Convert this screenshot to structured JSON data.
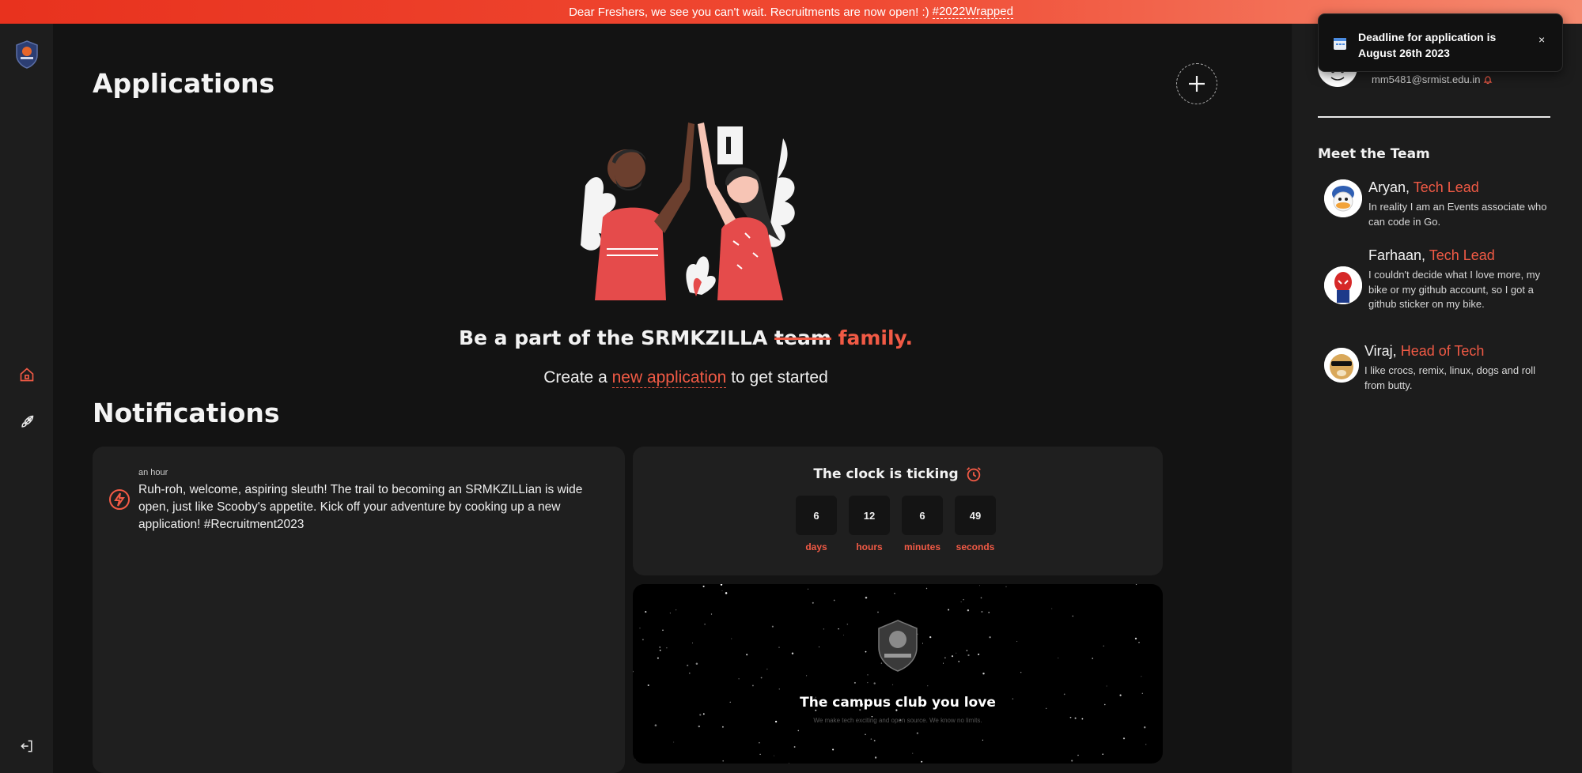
{
  "banner": {
    "text": "Dear Freshers, we see you can't wait. Recruitments are now open! :)",
    "tag": "#2022Wrapped"
  },
  "sidebar": {
    "logo_icon": "srmkzilla-shield-logo",
    "items": [
      {
        "icon": "home-icon",
        "active": true
      },
      {
        "icon": "rocket-icon",
        "active": false
      }
    ],
    "logout_icon": "logout-icon"
  },
  "applications": {
    "heading": "Applications",
    "add_icon": "plus-icon",
    "tagline_prefix": "Be a part of the SRMKZILLA",
    "tagline_struck": "team",
    "tagline_accent": "family.",
    "sub_prefix": "Create a",
    "sub_link": "new application",
    "sub_suffix": "to get started"
  },
  "notifications": {
    "heading": "Notifications",
    "items": [
      {
        "icon": "lightning-icon",
        "time": "an hour",
        "message": "Ruh-roh, welcome, aspiring sleuth! The trail to becoming an SRMKZILLian is wide open, just like Scooby's appetite. Kick off your adventure by cooking up a new application! #Recruitment2023"
      }
    ]
  },
  "countdown": {
    "title": "The clock is ticking",
    "icon": "alarm-clock-icon",
    "units": [
      {
        "value": "6",
        "label": "days"
      },
      {
        "value": "12",
        "label": "hours"
      },
      {
        "value": "6",
        "label": "minutes"
      },
      {
        "value": "49",
        "label": "seconds"
      }
    ]
  },
  "promo": {
    "title": "The campus club you love",
    "subtitle": "We make tech exciting and open source. We know no limits."
  },
  "profile": {
    "email": "mm5481@srmist.edu.in",
    "bell_icon": "bell-icon"
  },
  "team": {
    "heading": "Meet the Team",
    "members": [
      {
        "name": "Aryan,",
        "role": "Tech Lead",
        "bio": "In reality I am an Events associate who can code in Go.",
        "avatar": "donald-duck-avatar"
      },
      {
        "name": "Farhaan,",
        "role": "Tech Lead",
        "bio": "I couldn't decide what I love more, my bike or my github account, so I got a github sticker on my bike.",
        "avatar": "spiderman-avatar"
      },
      {
        "name": "Viraj,",
        "role": "Head of Tech",
        "bio": "I like crocs, remix, linux, dogs and roll from butty.",
        "avatar": "doge-avatar"
      }
    ]
  },
  "toast": {
    "icon": "calendar-icon",
    "message": "Deadline for application is August 26th 2023",
    "close": "×"
  },
  "colors": {
    "accent": "#f15a45",
    "background": "#131313",
    "card": "#1f1f1f",
    "banner_start": "#e8321e",
    "banner_end": "#f58a70"
  }
}
